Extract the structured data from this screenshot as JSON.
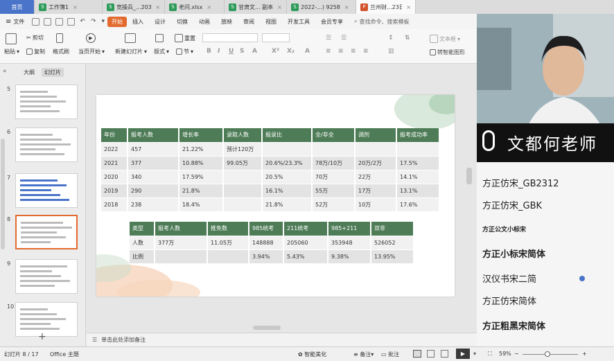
{
  "tabs": [
    {
      "label": "首页",
      "type": "home"
    },
    {
      "label": "工作簿1",
      "icon": "S"
    },
    {
      "label": "竞操兵_...2035",
      "icon": "S"
    },
    {
      "label": "老问.xlsx",
      "icon": "S"
    },
    {
      "label": "甘肃文... 副本",
      "icon": "S"
    },
    {
      "label": "2022-...) 9258",
      "icon": "S"
    },
    {
      "label": "兰州财...23日",
      "icon": "P"
    }
  ],
  "menu": {
    "file": "文件",
    "items": [
      "开始",
      "插入",
      "设计",
      "切换",
      "动画",
      "放映",
      "审阅",
      "视图",
      "开发工具",
      "会员专享"
    ],
    "search": "查找命令、搜索模板"
  },
  "ribbon": {
    "paste": "粘贴",
    "cut": "剪切",
    "copy": "复制",
    "format_painter": "格式刷",
    "play_from_current": "当页开始",
    "new_slide": "新建幻灯片",
    "layout": "版式",
    "section": "节",
    "reset": "重置",
    "text_box": "文本框",
    "arrange": "排列",
    "smart_shape": "转智能图形"
  },
  "left_pane": {
    "tabs": [
      "大纲",
      "幻灯片"
    ],
    "slide_numbers": [
      "5",
      "6",
      "7",
      "8",
      "9",
      "10"
    ],
    "add": "+"
  },
  "table1": {
    "headers": [
      "年份",
      "报考人数",
      "增长率",
      "录取人数",
      "报录比",
      "全/非全",
      "调剂",
      "报考成功率"
    ],
    "rows": [
      [
        "2022",
        "457",
        "21.22%",
        "预计120万",
        "",
        "",
        "",
        ""
      ],
      [
        "2021",
        "377",
        "10.88%",
        "99.05万",
        "20.6%/23.3%",
        "78万/10万",
        "20万/2万",
        "17.5%"
      ],
      [
        "2020",
        "340",
        "17.59%",
        "",
        "20.5%",
        "70万",
        "22万",
        "14.1%"
      ],
      [
        "2019",
        "290",
        "21.8%",
        "",
        "16.1%",
        "55万",
        "17万",
        "13.1%"
      ],
      [
        "2018",
        "238",
        "18.4%",
        "",
        "21.8%",
        "52万",
        "10万",
        "17.6%"
      ]
    ]
  },
  "table2": {
    "headers": [
      "类型",
      "报考人数",
      "推免数",
      "985统考",
      "211统考",
      "985+211",
      "双非"
    ],
    "rows": [
      [
        "人数",
        "377万",
        "11.05万",
        "148888",
        "205060",
        "353948",
        "526052"
      ],
      [
        "比例",
        "",
        "",
        "3.94%",
        "5.43%",
        "9.38%",
        "13.95%"
      ]
    ]
  },
  "notes_placeholder": "单击此处添加备注",
  "status": {
    "slide_count": "幻灯片 8 / 17",
    "theme": "Office 主题",
    "smart_beautify": "智能美化",
    "notes": "备注",
    "comments": "批注",
    "zoom": "59%"
  },
  "overlay": {
    "teacher_label": "文都何老师"
  },
  "font_list": [
    "方正仿宋_GB2312",
    "方正仿宋_GBK",
    "方正公文小标宋",
    "方正小标宋简体",
    "汉仪书宋二简",
    "方正仿宋简体",
    "方正粗黑宋简体"
  ],
  "colors": {
    "accent": "#e36a2e",
    "table_header": "#4e7c57",
    "home_tab": "#4a74c9"
  }
}
